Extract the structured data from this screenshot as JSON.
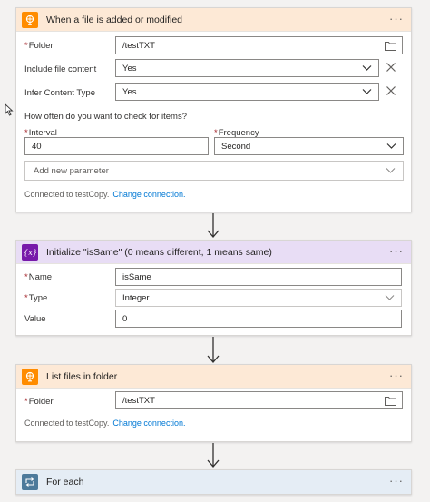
{
  "trigger_card": {
    "title": "When a file is added or modified",
    "more": "···",
    "folder_label": "Folder",
    "folder_value": "/testTXT",
    "include_label": "Include file content",
    "include_value": "Yes",
    "infer_label": "Infer Content Type",
    "infer_value": "Yes",
    "check_question": "How often do you want to check for items?",
    "interval_label": "Interval",
    "interval_value": "40",
    "frequency_label": "Frequency",
    "frequency_value": "Second",
    "add_param": "Add new parameter",
    "connected_text": "Connected to testCopy.",
    "change_link": "Change connection."
  },
  "init_card": {
    "title": "Initialize \"isSame\" (0 means different, 1 means same)",
    "more": "···",
    "name_label": "Name",
    "name_value": "isSame",
    "type_label": "Type",
    "type_value": "Integer",
    "value_label": "Value",
    "value_value": "0"
  },
  "list_card": {
    "title": "List files in folder",
    "more": "···",
    "folder_label": "Folder",
    "folder_value": "/testTXT",
    "connected_text": "Connected to testCopy.",
    "change_link": "Change connection."
  },
  "foreach_card": {
    "title": "For each",
    "more": "···"
  },
  "colors": {
    "trigger_header": "#fde9d6",
    "variable_header": "#e8ddf5",
    "foreach_header": "#e5edf5",
    "link": "#0078d4",
    "required": "#a4262c"
  },
  "icons": {
    "trigger": "ftp-connector-icon",
    "variable": "variable-icon",
    "list": "ftp-connector-icon",
    "foreach": "loop-icon"
  }
}
